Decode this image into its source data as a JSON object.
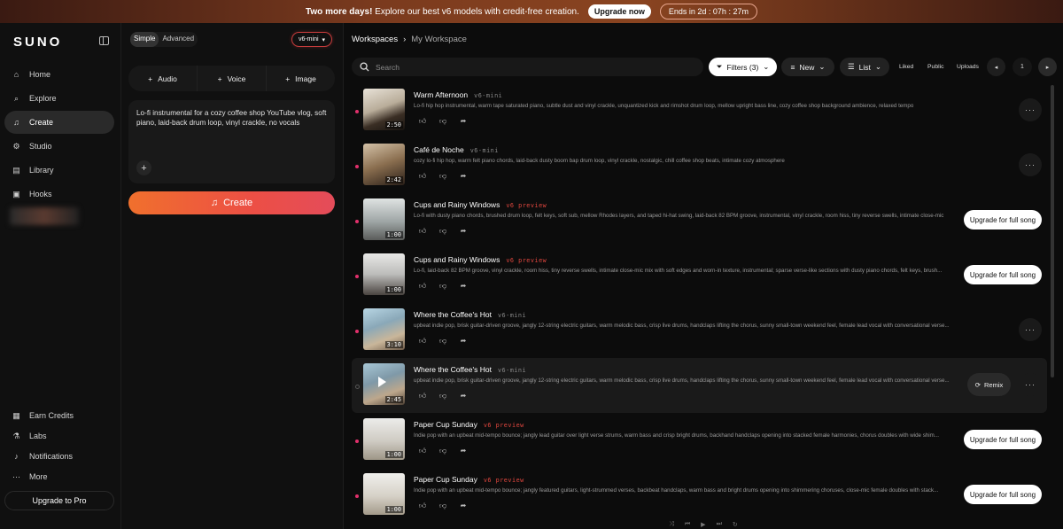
{
  "banner": {
    "headline": "Two more days!",
    "text": "Explore our best v6 models with credit-free creation.",
    "cta": "Upgrade now",
    "countdown": "Ends in 2d : 07h : 27m"
  },
  "sidebar": {
    "logo": "SUNO",
    "items": [
      {
        "label": "Home",
        "icon": "home-icon"
      },
      {
        "label": "Explore",
        "icon": "explore-icon"
      },
      {
        "label": "Create",
        "icon": "create-icon"
      },
      {
        "label": "Studio",
        "icon": "studio-icon"
      },
      {
        "label": "Library",
        "icon": "library-icon"
      },
      {
        "label": "Hooks",
        "icon": "hooks-icon"
      }
    ],
    "bottom": [
      {
        "label": "Earn Credits",
        "icon": "gift-icon"
      },
      {
        "label": "Labs",
        "icon": "flask-icon"
      },
      {
        "label": "Notifications",
        "icon": "bell-icon"
      },
      {
        "label": "More",
        "icon": "more-icon"
      }
    ],
    "upgrade": "Upgrade to Pro"
  },
  "create": {
    "mode_simple": "Simple",
    "mode_advanced": "Advanced",
    "model": "v6-mini",
    "tabs": [
      "Audio",
      "Voice",
      "Image"
    ],
    "prompt": "Lo-fi instrumental for a cozy coffee shop YouTube vlog, soft piano, laid-back drum loop, vinyl crackle, no vocals",
    "button": "Create"
  },
  "main": {
    "crumb_root": "Workspaces",
    "crumb_current": "My Workspace",
    "search_placeholder": "Search",
    "filters": "Filters (3)",
    "sort": "New",
    "view": "List",
    "toggles": [
      "Liked",
      "Public",
      "Uploads"
    ],
    "page": "1"
  },
  "songs": [
    {
      "title": "Warm Afternoon",
      "model": "v6-mini",
      "preview": false,
      "duration": "2:50",
      "desc": "Lo-fi hip hop instrumental, warm tape saturated piano, subtle dust and vinyl crackle, unquantized kick and rimshot drum loop, mellow upright bass line, cozy coffee shop background ambience, relaxed tempo",
      "action": "more"
    },
    {
      "title": "Café de Noche",
      "model": "v6-mini",
      "preview": false,
      "duration": "2:42",
      "desc": "cozy lo-fi hip hop, warm felt piano chords, laid-back dusty boom bap drum loop, vinyl crackle, nostalgic, chill coffee shop beats, intimate cozy atmosphere",
      "action": "more"
    },
    {
      "title": "Cups and Rainy Windows",
      "model": "v6 preview",
      "preview": true,
      "duration": "1:00",
      "desc": "Lo-fi with dusty piano chords, brushed drum loop, felt keys, soft sub, mellow Rhodes layers, and taped hi-hat swing, laid-back 82 BPM groove, instrumental, vinyl crackle, room hiss, tiny reverse swells, intimate close-mic",
      "action": "upgrade"
    },
    {
      "title": "Cups and Rainy Windows",
      "model": "v6 preview",
      "preview": true,
      "duration": "1:00",
      "desc": "Lo-fi, laid-back 82 BPM groove, vinyl crackle, room hiss, tiny reverse swells, intimate close-mic mix with soft edges and worn-in texture, instrumental; sparse verse-like sections with dusty piano chords, felt keys, brush...",
      "action": "upgrade"
    },
    {
      "title": "Where the Coffee's Hot",
      "model": "v6-mini",
      "preview": false,
      "duration": "3:10",
      "desc": "upbeat indie pop, brisk guitar-driven groove, jangly 12-string electric guitars, warm melodic bass, crisp live drums, handclaps lifting the chorus, sunny small-town weekend feel, female lead vocal with conversational verse...",
      "action": "more"
    },
    {
      "title": "Where the Coffee's Hot",
      "model": "v6-mini",
      "preview": false,
      "duration": "2:45",
      "desc": "upbeat indie pop, brisk guitar-driven groove, jangly 12-string electric guitars, warm melodic bass, crisp live drums, handclaps lifting the chorus, sunny small-town weekend feel, female lead vocal with conversational verse...",
      "action": "remix",
      "remix": "Remix"
    },
    {
      "title": "Paper Cup Sunday",
      "model": "v6 preview",
      "preview": true,
      "duration": "1:00",
      "desc": "Indie pop with an upbeat mid-tempo bounce; jangly lead guitar over light verse strums, warm bass and crisp bright drums, backhand handclaps opening into stacked female harmonies, chorus doubles with wide shim...",
      "action": "upgrade"
    },
    {
      "title": "Paper Cup Sunday",
      "model": "v6 preview",
      "preview": true,
      "duration": "1:00",
      "desc": "Indie pop with an upbeat mid-tempo bounce; jangly featured guitars, light-strummed verses, backbeat handclaps, warm bass and bright drums opening into shimmering choruses, close-mic female doubles with stack...",
      "action": "upgrade"
    }
  ],
  "upgrade_label": "Upgrade for full song"
}
